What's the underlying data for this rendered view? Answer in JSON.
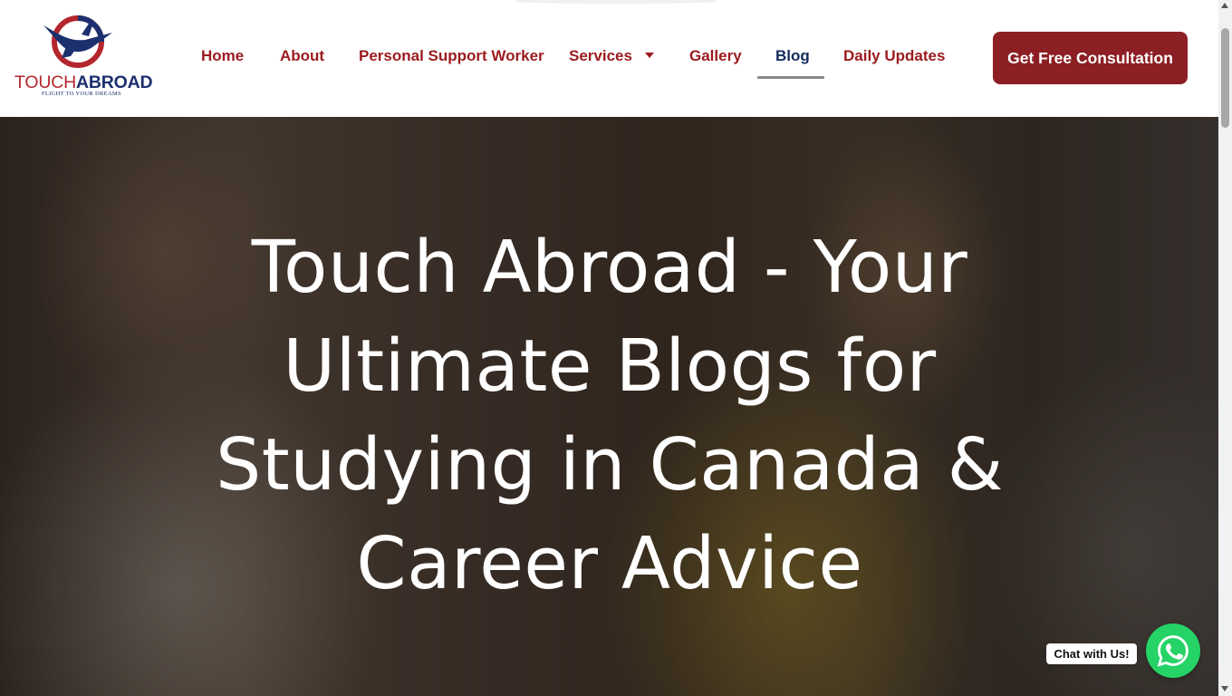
{
  "brand": {
    "logo_word_touch": "TOUCH",
    "logo_word_abroad": "ABROAD",
    "logo_tagline": "FLIGHT TO YOUR DREAMS",
    "colors": {
      "red": "#9b1b1e",
      "navy": "#1c2f6e",
      "cta": "#8c1f24"
    }
  },
  "nav": {
    "items": [
      {
        "label": "Home"
      },
      {
        "label": "About"
      },
      {
        "label": "Personal Support Worker"
      },
      {
        "label": "Services",
        "has_dropdown": true,
        "icon": "caret-down-icon"
      },
      {
        "label": "Gallery"
      },
      {
        "label": "Blog",
        "active": true
      },
      {
        "label": "Daily Updates"
      }
    ],
    "cta_label": "Get Free Consultation"
  },
  "hero": {
    "title": "Touch Abroad - Your Ultimate Blogs for Studying in Canada & Career Advice"
  },
  "chat": {
    "label": "Chat with Us!",
    "icon": "whatsapp-icon",
    "color": "#25d366"
  }
}
